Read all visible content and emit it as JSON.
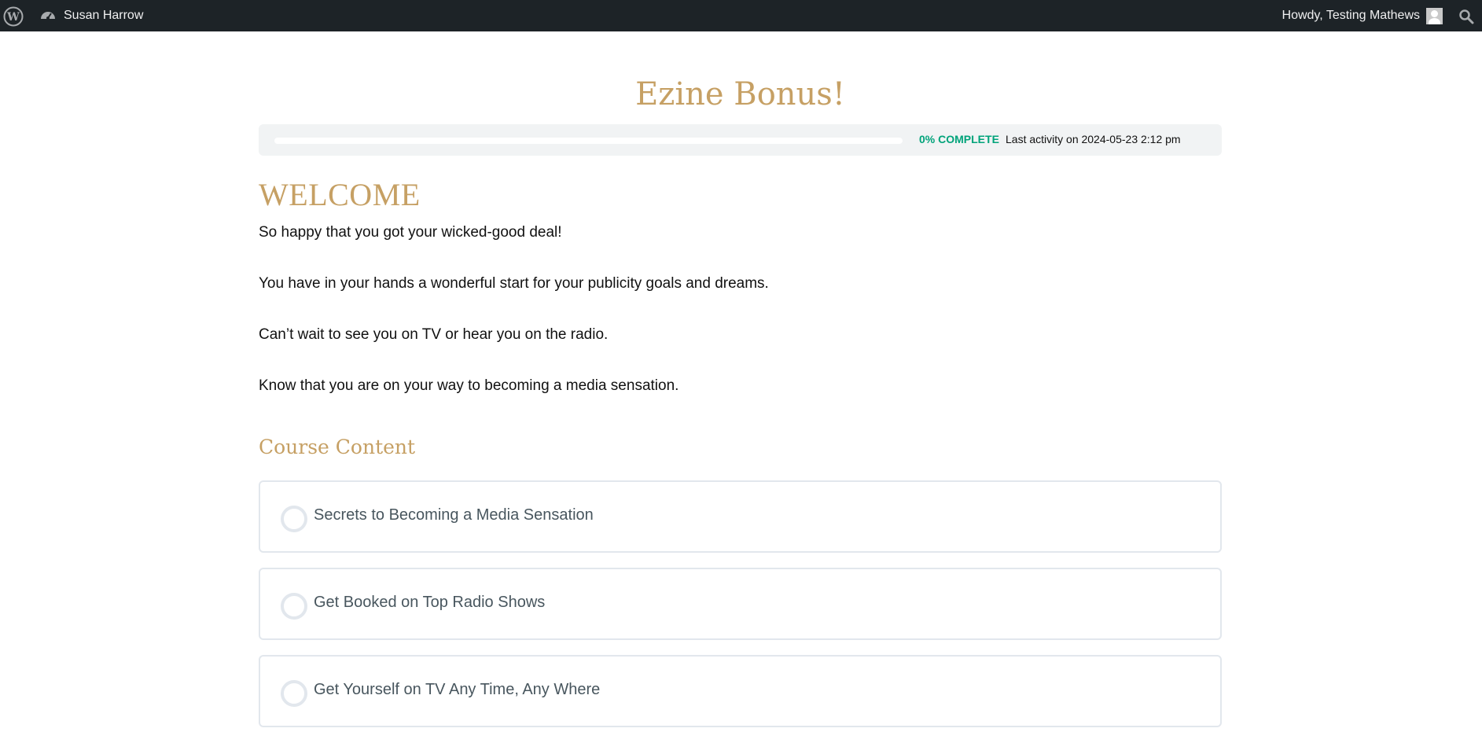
{
  "adminbar": {
    "site_name": "Susan Harrow",
    "howdy_text": "Howdy, Testing Mathews",
    "icons": [
      "wordpress-logo-icon",
      "dashboard-icon",
      "avatar",
      "search-icon"
    ]
  },
  "course": {
    "title": "Ezine Bonus!",
    "progress": {
      "percent_label": "0% COMPLETE",
      "percent_value": 0,
      "last_activity": "Last activity on 2024-05-23 2:12 pm"
    }
  },
  "welcome": {
    "heading": "WELCOME",
    "paragraphs": [
      "So happy that you got your wicked-good deal!",
      "You have in your hands a wonderful start for your publicity goals and dreams.",
      "Can’t wait to see you on TV or hear you on the radio.",
      "Know that you are on your way to becoming a media sensation."
    ]
  },
  "course_content": {
    "heading": "Course Content",
    "lessons": [
      {
        "title": "Secrets to Becoming a Media Sensation"
      },
      {
        "title": "Get Booked on Top Radio Shows"
      },
      {
        "title": "Get Yourself on TV Any Time, Any Where"
      }
    ]
  },
  "colors": {
    "adminbar_bg": "#1d2327",
    "accent_gold": "#c6a064",
    "progress_green": "#00a37a",
    "border": "#e2e7ed"
  }
}
